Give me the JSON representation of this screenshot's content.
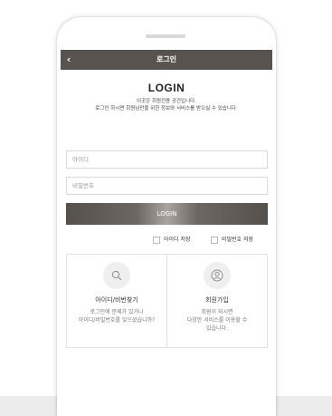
{
  "header": {
    "title": "로그인",
    "back_icon": "chevron-left-icon"
  },
  "login": {
    "heading": "LOGIN",
    "subtitle_line1": "이곳은 회원전용 공간입니다.",
    "subtitle_line2": "로그인 하시면 회원님만을 위한 정보와 서비스를 받으실 수 있습니다.",
    "id_placeholder": "아이디",
    "password_placeholder": "비밀번호",
    "button_label": "LOGIN",
    "save_id_label": "아이디 저장",
    "save_password_label": "비밀번호 저장"
  },
  "cards": {
    "find": {
      "icon": "search-icon",
      "title": "아이디/비번찾기",
      "desc_line1": "로그인에 문제가 있거나",
      "desc_line2": "아이디/비밀번호를 잊으셨습니까?"
    },
    "join": {
      "icon": "user-icon",
      "title": "회원가입",
      "desc_line1": "회원이 되시면",
      "desc_line2": "다양한 서비스를 이용할 수",
      "desc_line3": "있습니다."
    }
  },
  "colors": {
    "appbar": "#58534f",
    "button": "#58534f",
    "border": "#d9d9d9"
  }
}
